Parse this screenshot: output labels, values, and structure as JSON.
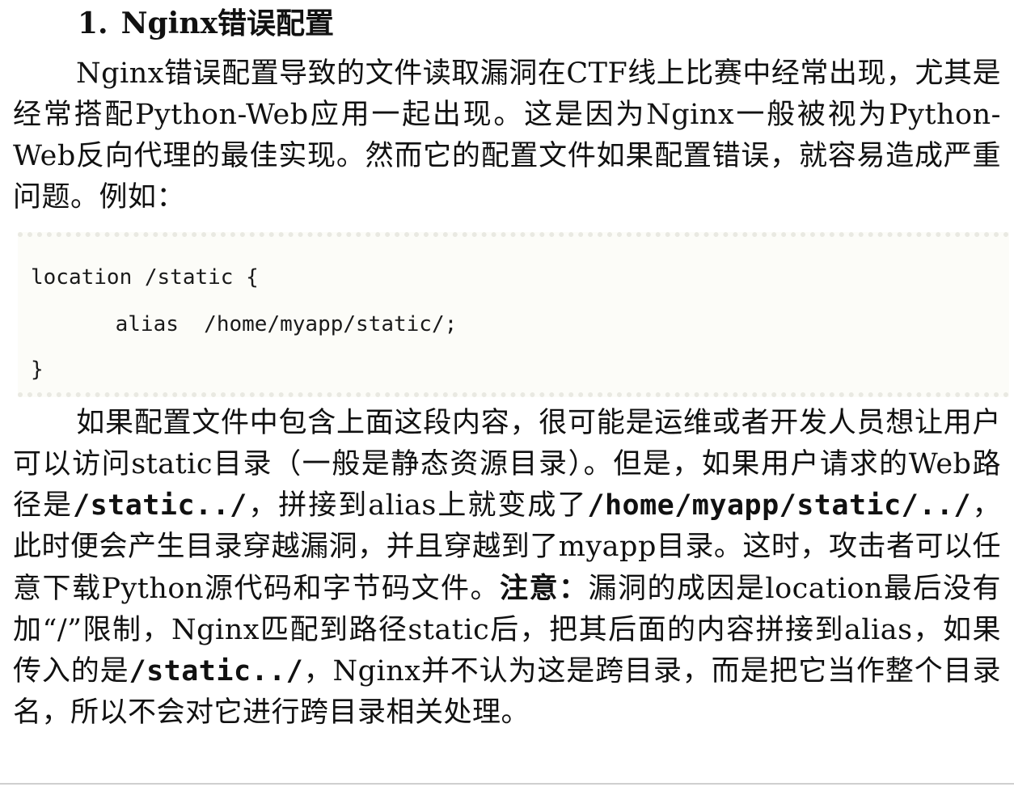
{
  "section": {
    "number": "1.",
    "title": "Nginx错误配置"
  },
  "intro": {
    "text": "Nginx错误配置导致的文件读取漏洞在CTF线上比赛中经常出现，尤其是经常搭配Python-Web应用一起出现。这是因为Nginx一般被视为Python-Web反向代理的最佳实现。然而它的配置文件如果配置错误，就容易造成严重问题。例如："
  },
  "code": {
    "lines": [
      "location /static {",
      "    alias  /home/myapp/static/;",
      "}"
    ]
  },
  "explanation": {
    "t1": "如果配置文件中包含上面这段内容，很可能是运维或者开发人员想让用户可以访问static目录（一般是静态资源目录）。但是，如果用户请求的Web路径是",
    "c1": "/static../",
    "t2": "，拼接到alias上就变成了",
    "c2": "/home/myapp/static/../",
    "t3": "，此时便会产生目录穿越漏洞，并且穿越到了myapp目录。这时，攻击者可以任意下载Python源代码和字节码文件。",
    "note_label": "注意：",
    "t4": "漏洞的成因是location最后没有加“/”限制，Nginx匹配到路径static后，把其后面的内容拼接到alias，如果传入的是",
    "c3": "/static../",
    "t5": "，Nginx并不认为这是跨目录，而是把它当作整个目录名，所以不会对它进行跨目录相关处理。"
  }
}
